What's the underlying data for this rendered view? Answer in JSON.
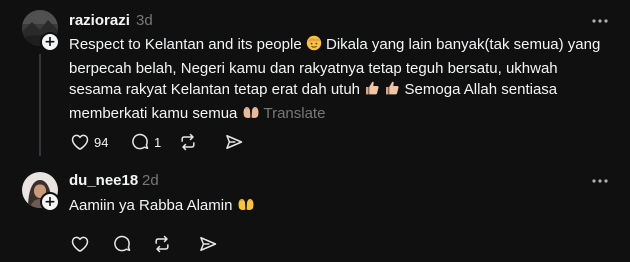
{
  "posts": [
    {
      "username": "raziorazi",
      "timestamp": "3d",
      "text_1": "Respect to Kelantan and its people ",
      "text_2": " Dikala yang lain banyak(tak semua) yang berpecah belah, Negeri kamu dan rakyatnya tetap teguh bersatu, ukhwah sesama rakyat Kelantan tetap erat dah utuh ",
      "text_3": " Semoga Allah sentiasa memberkati kamu semua ",
      "translate_label": "Translate",
      "likes": "94",
      "replies": "1",
      "icons": [
        "face-emoji-icon",
        "thumbs-up-icon",
        "thumbs-up-icon",
        "open-hands-icon"
      ]
    },
    {
      "username": "du_nee18",
      "timestamp": "2d",
      "text_1": "Aamiin ya Rabba Alamin ",
      "icons": [
        "open-hands-icon"
      ]
    }
  ],
  "action_icons": [
    "heart-icon",
    "comment-icon",
    "repost-icon",
    "share-icon",
    "more-icon",
    "plus-icon"
  ],
  "colors": {
    "background": "#101010",
    "primary_text": "#f3f5f7",
    "secondary_text": "#777777",
    "thread_line": "#333638"
  }
}
